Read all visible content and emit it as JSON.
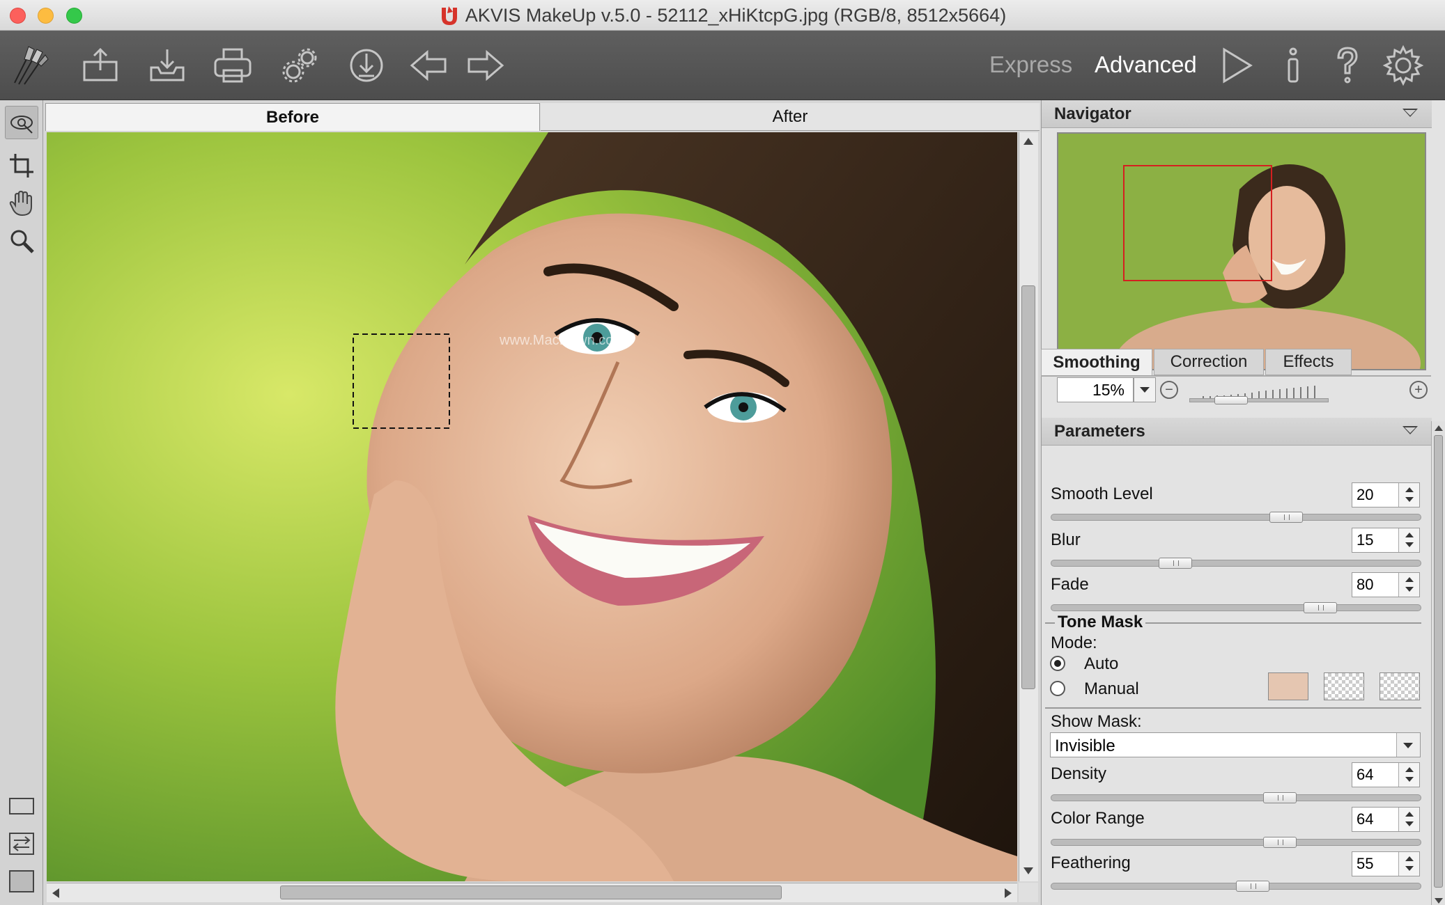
{
  "window": {
    "title": "AKVIS MakeUp v.5.0 - 52112_xHiKtcpG.jpg (RGB/8, 8512x5664)"
  },
  "toolbar": {
    "icons": [
      "makeup-brushes-icon",
      "open-image-icon",
      "save-image-icon",
      "print-icon",
      "batch-processing-icon",
      "share-icon",
      "undo-arrow-icon",
      "redo-arrow-icon",
      "run-icon",
      "info-icon",
      "help-icon",
      "preferences-gear-icon"
    ],
    "mode_express": "Express",
    "mode_advanced": "Advanced"
  },
  "image_tabs": {
    "before": "Before",
    "after": "After"
  },
  "watermark": "www.MacDown.com",
  "navigator": {
    "title": "Navigator",
    "zoom": "15%"
  },
  "parameters": {
    "title": "Parameters",
    "tabs": [
      "Smoothing",
      "Correction",
      "Effects"
    ],
    "smooth_level": {
      "label": "Smooth Level",
      "value": "20",
      "level": 0.65
    },
    "blur": {
      "label": "Blur",
      "value": "15",
      "level": 0.32
    },
    "fade": {
      "label": "Fade",
      "value": "80",
      "level": 0.75
    },
    "tone_mask": {
      "title": "Tone Mask",
      "mode_label": "Mode:",
      "auto": "Auto",
      "manual": "Manual",
      "selected": "Auto",
      "swatch_color": "#e5c6b1",
      "show_mask_label": "Show Mask:",
      "show_mask_value": "Invisible"
    },
    "density": {
      "label": "Density",
      "value": "64",
      "level": 0.63
    },
    "color_range": {
      "label": "Color Range",
      "value": "64",
      "level": 0.63
    },
    "feathering": {
      "label": "Feathering",
      "value": "55",
      "level": 0.55
    }
  }
}
